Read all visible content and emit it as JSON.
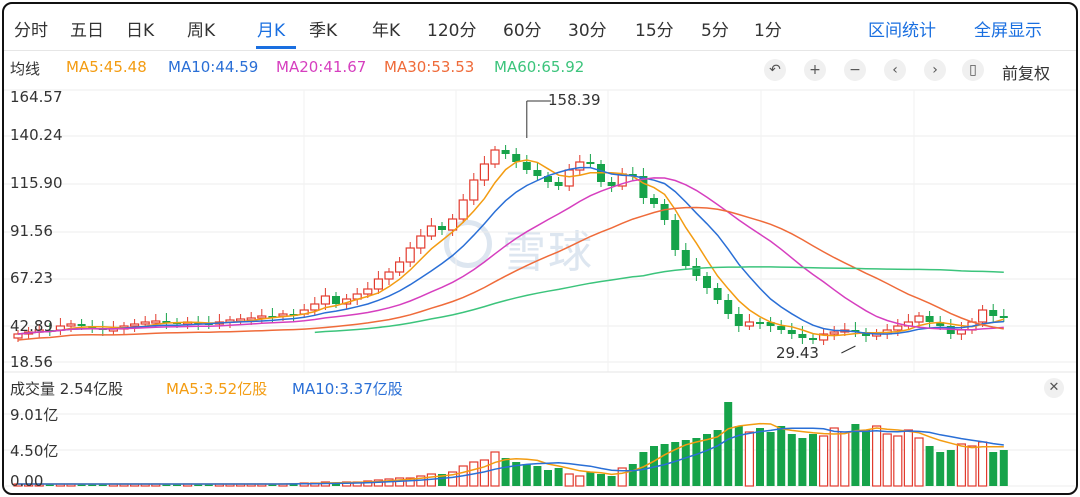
{
  "tabs": [
    "分时",
    "五日",
    "日K",
    "周K",
    "月K",
    "季K",
    "年K",
    "120分",
    "60分",
    "30分",
    "15分",
    "5分",
    "1分"
  ],
  "active_tab": "月K",
  "actions": {
    "range_stats": "区间统计",
    "fullscreen": "全屏显示"
  },
  "ma_legend": {
    "title": "均线",
    "items": [
      {
        "label": "MA5:45.48",
        "color": "#f39c12"
      },
      {
        "label": "MA10:44.59",
        "color": "#2a6fd6"
      },
      {
        "label": "MA20:41.67",
        "color": "#d63fbf"
      },
      {
        "label": "MA30:53.53",
        "color": "#ef6b3a"
      },
      {
        "label": "MA60:65.92",
        "color": "#3cc47c"
      }
    ]
  },
  "toolbar": {
    "icons": [
      "undo-icon",
      "zoom-in-icon",
      "zoom-out-icon",
      "left-icon",
      "right-icon",
      "candle-icon"
    ],
    "adjust_label": "前复权"
  },
  "price_axis": {
    "labels": [
      "164.57",
      "140.24",
      "115.90",
      "91.56",
      "67.23",
      "42.89",
      "18.56"
    ]
  },
  "annotations": {
    "max": "158.39",
    "min": "29.43"
  },
  "watermark": "雪球",
  "volume_legend": {
    "title": "成交量 2.54亿股",
    "ma5": "MA5:3.52亿股",
    "ma10": "MA10:3.37亿股"
  },
  "volume_axis": {
    "labels": [
      "9.01亿",
      "4.50亿",
      "0.00"
    ]
  },
  "colors": {
    "up": "#e23b2e",
    "down": "#16a34a",
    "ma5": "#f39c12",
    "ma10": "#2a6fd6",
    "ma20": "#d63fbf",
    "ma30": "#ef6b3a",
    "ma60": "#3cc47c",
    "accent": "#1a6fe0"
  }
}
